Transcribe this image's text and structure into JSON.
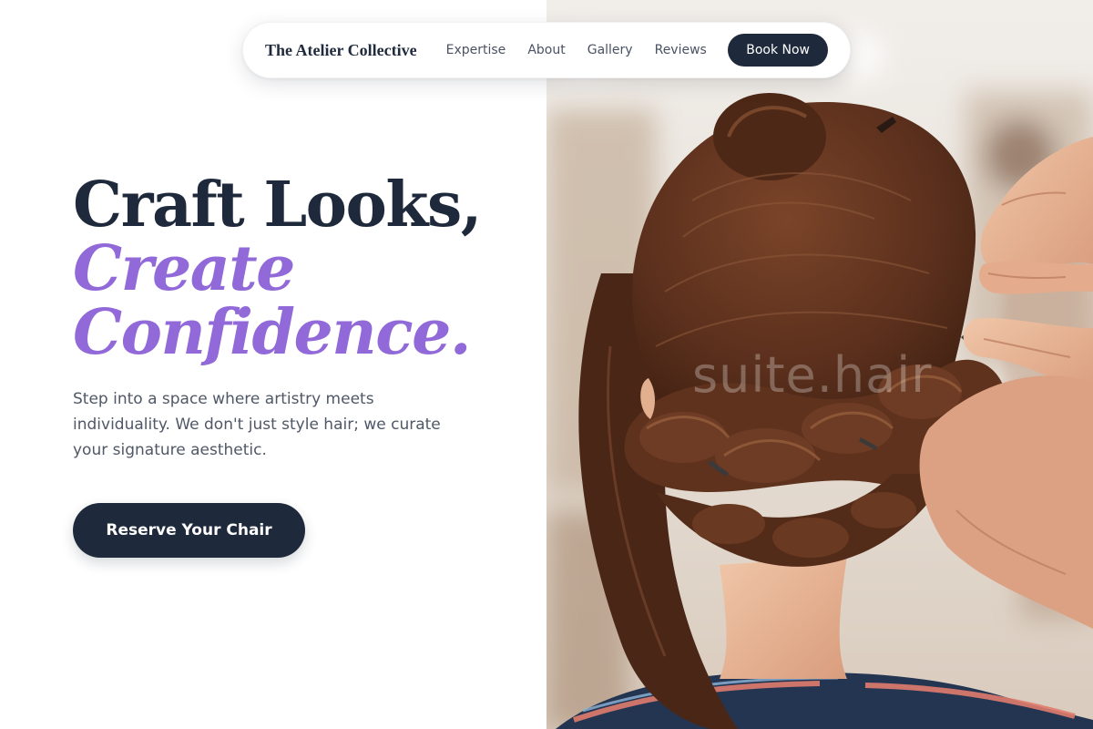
{
  "nav": {
    "brand": "The Atelier Collective",
    "links": [
      "Expertise",
      "About",
      "Gallery",
      "Reviews"
    ],
    "cta_label": "Book Now"
  },
  "hero": {
    "headline_line1": "Craft Looks,",
    "headline_line2": "Create",
    "headline_line3": "Confidence.",
    "description": "Step into a space where artistry meets individuality. We don't just style hair; we curate your signature aesthetic.",
    "cta_label": "Reserve Your Chair"
  },
  "photo": {
    "watermark": "suite.hair"
  },
  "colors": {
    "navy": "#1e2a3c",
    "accent_purple": "#9169d8",
    "body_text": "#4f5867",
    "hair": "#5a2f1c",
    "skin": "#e3b597"
  }
}
